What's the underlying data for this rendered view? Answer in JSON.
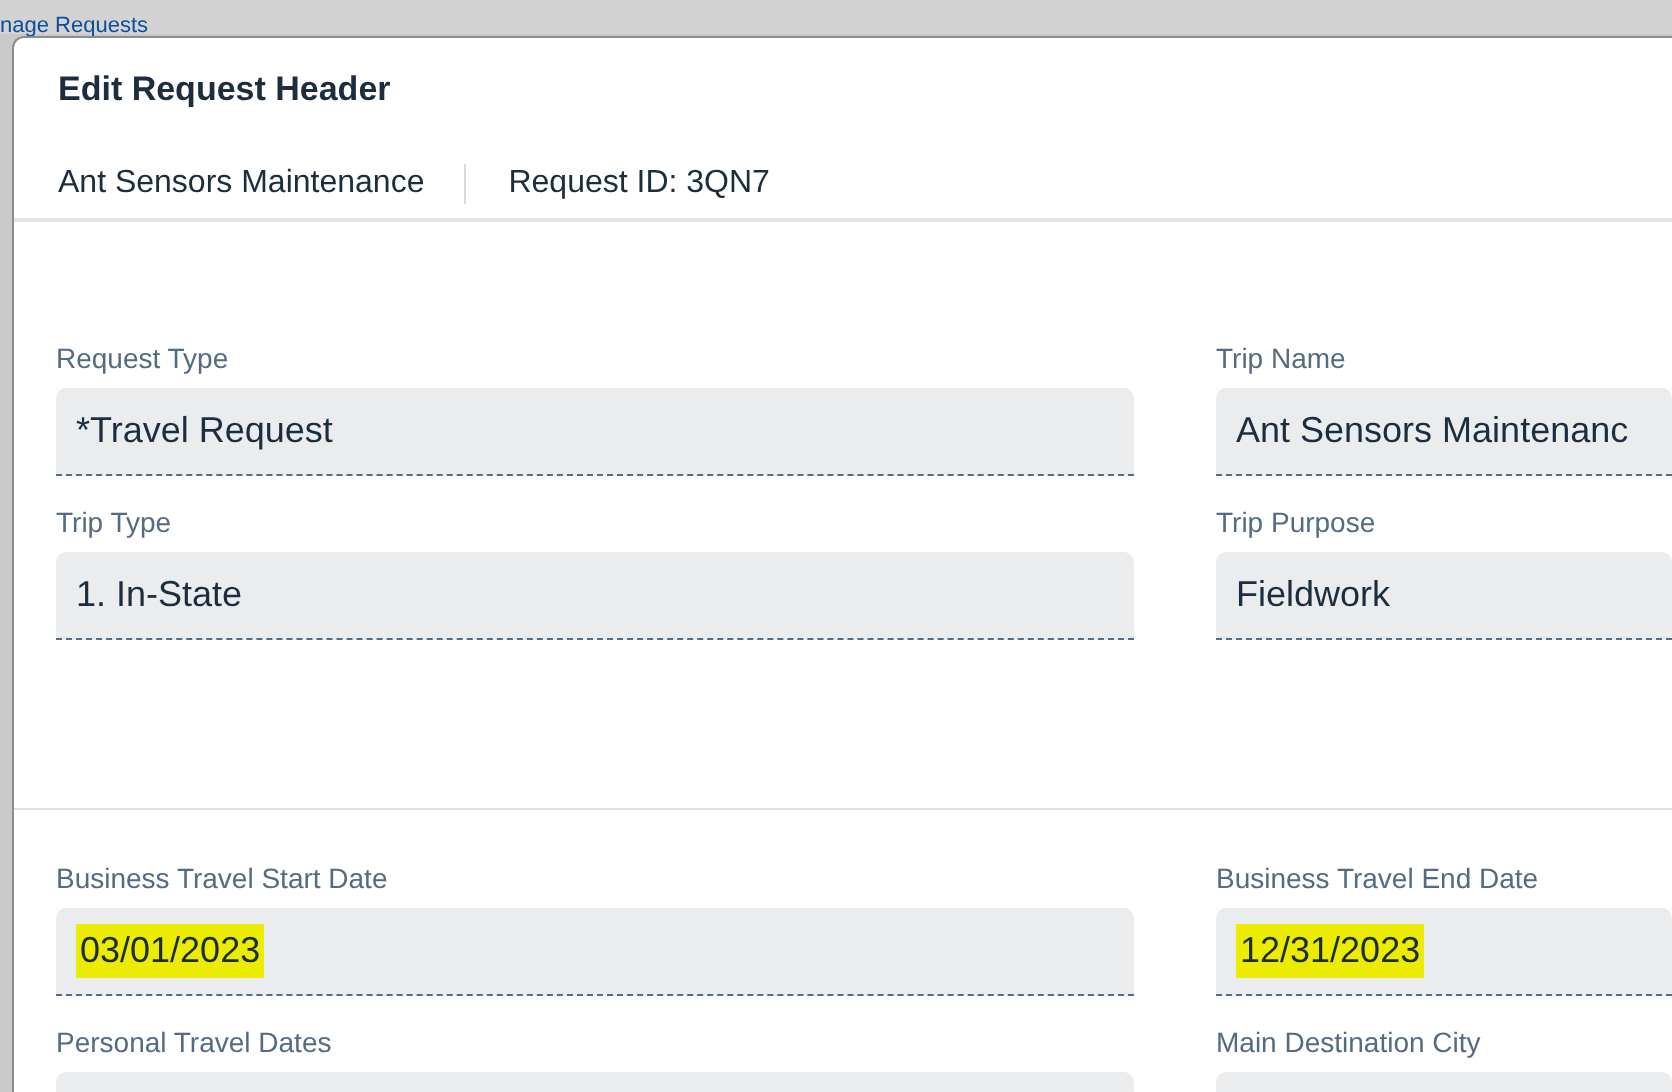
{
  "background": {
    "link": "nage Requests"
  },
  "dialog": {
    "title": "Edit Request Header",
    "subtitle": {
      "trip": "Ant Sensors Maintenance",
      "request_id": "Request ID: 3QN7"
    }
  },
  "sections": [
    {
      "fields": [
        {
          "label": "Request Type",
          "value": "*Travel Request",
          "highlighted": false
        },
        {
          "label": "Trip Name",
          "value": "Ant Sensors Maintenanc",
          "highlighted": false
        },
        {
          "label": "Trip Type",
          "value": "1. In-State",
          "highlighted": false
        },
        {
          "label": "Trip Purpose",
          "value": "Fieldwork",
          "highlighted": false
        }
      ]
    },
    {
      "fields": [
        {
          "label": "Business Travel Start Date",
          "value": "03/01/2023",
          "highlighted": true
        },
        {
          "label": "Business Travel End Date",
          "value": "12/31/2023",
          "highlighted": true
        },
        {
          "label": "Personal Travel Dates",
          "highlighted": false
        },
        {
          "label": "Main Destination City",
          "highlighted": false
        }
      ]
    }
  ]
}
